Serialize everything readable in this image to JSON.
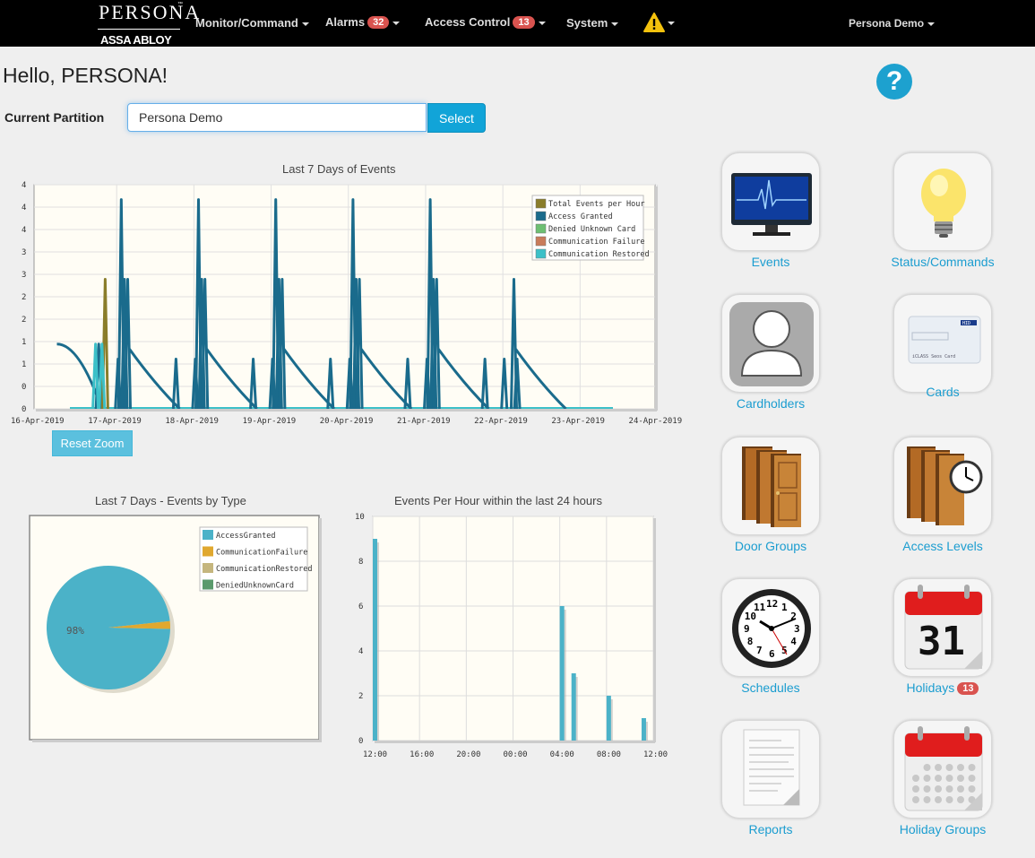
{
  "nav": {
    "logo_top": "PERSONA",
    "logo_tm": "™",
    "logo_bottom": "ASSA ABLOY",
    "items": [
      {
        "label": "Monitor/Command"
      },
      {
        "label": "Alarms",
        "badge": "32"
      },
      {
        "label": "Access Control",
        "badge": "13"
      },
      {
        "label": "System"
      }
    ],
    "warning_icon": "warning-triangle-icon",
    "user": "Persona Demo"
  },
  "greeting": "Hello, PERSONA!",
  "help_icon": "?",
  "partition": {
    "label": "Current Partition",
    "value": "Persona Demo",
    "select_label": "Select"
  },
  "colors": {
    "accent": "#1b9dd0",
    "badge": "#d9534f",
    "access_granted": "#1a6b8c",
    "pie_granted": "#4bb2c8",
    "pie_failure": "#e0a82f"
  },
  "charts": {
    "timeline": {
      "title": "Last 7 Days of Events",
      "y_ticks": [
        "4",
        "4",
        "4",
        "3",
        "3",
        "2",
        "2",
        "1",
        "1",
        "0",
        "0"
      ],
      "x_ticks": [
        "16-Apr-2019",
        "17-Apr-2019",
        "18-Apr-2019",
        "19-Apr-2019",
        "20-Apr-2019",
        "21-Apr-2019",
        "22-Apr-2019",
        "23-Apr-2019",
        "24-Apr-2019"
      ],
      "legend": [
        {
          "name": "Total Events per Hour",
          "color": "#8a7d2a"
        },
        {
          "name": "Access Granted",
          "color": "#1a6b8c"
        },
        {
          "name": "Denied Unknown Card",
          "color": "#6dbf72"
        },
        {
          "name": "Communication Failure",
          "color": "#c97b5a"
        },
        {
          "name": "Communication Restored",
          "color": "#3cc0c8"
        }
      ],
      "reset_label": "Reset Zoom"
    },
    "pie": {
      "title": "Last 7 Days - Events by Type",
      "legend": [
        {
          "name": "AccessGranted",
          "color": "#4bb2c8"
        },
        {
          "name": "CommunicationFailure",
          "color": "#e0a82f"
        },
        {
          "name": "CommunicationRestored",
          "color": "#c5b67e"
        },
        {
          "name": "DeniedUnknownCard",
          "color": "#5a9a6c"
        }
      ],
      "label": "98%"
    },
    "hourly": {
      "title": "Events Per Hour within the last 24 hours",
      "y_ticks": [
        "0",
        "2",
        "4",
        "6",
        "8",
        "10"
      ],
      "x_ticks": [
        "12:00",
        "16:00",
        "20:00",
        "00:00",
        "04:00",
        "08:00",
        "12:00"
      ]
    }
  },
  "chart_data": [
    {
      "type": "line",
      "title": "Last 7 Days of Events",
      "x": [
        "16-Apr-2019",
        "17-Apr-2019",
        "18-Apr-2019",
        "19-Apr-2019",
        "20-Apr-2019",
        "21-Apr-2019",
        "22-Apr-2019",
        "23-Apr-2019",
        "24-Apr-2019"
      ],
      "series": [
        {
          "name": "Access Granted",
          "peaks": [
            {
              "date": "16-Apr-2019 11:00",
              "y": 1.3
            },
            {
              "date": "17-Apr-2019 00:00",
              "y": 1.3
            },
            {
              "date": "17-Apr-2019 06:00",
              "y": 1
            },
            {
              "date": "17-Apr-2019 07:00",
              "y": 4.2
            },
            {
              "date": "17-Apr-2019 08:00",
              "y": 2.6
            },
            {
              "date": "17-Apr-2019 09:00",
              "y": 2.6
            },
            {
              "date": "18-Apr-2019 00:00",
              "y": 1
            },
            {
              "date": "18-Apr-2019 06:00",
              "y": 1
            },
            {
              "date": "18-Apr-2019 07:00",
              "y": 4.2
            },
            {
              "date": "18-Apr-2019 08:00",
              "y": 2.6
            },
            {
              "date": "18-Apr-2019 09:00",
              "y": 2.6
            },
            {
              "date": "19-Apr-2019 00:00",
              "y": 1
            },
            {
              "date": "19-Apr-2019 06:00",
              "y": 1
            },
            {
              "date": "19-Apr-2019 07:00",
              "y": 4.2
            },
            {
              "date": "19-Apr-2019 08:00",
              "y": 2.6
            },
            {
              "date": "19-Apr-2019 09:00",
              "y": 2.6
            },
            {
              "date": "20-Apr-2019 00:00",
              "y": 1
            },
            {
              "date": "20-Apr-2019 06:00",
              "y": 1
            },
            {
              "date": "20-Apr-2019 07:00",
              "y": 4.2
            },
            {
              "date": "20-Apr-2019 08:00",
              "y": 2.6
            },
            {
              "date": "20-Apr-2019 09:00",
              "y": 2.6
            },
            {
              "date": "21-Apr-2019 00:00",
              "y": 1
            },
            {
              "date": "21-Apr-2019 06:00",
              "y": 1
            },
            {
              "date": "21-Apr-2019 07:00",
              "y": 4.2
            },
            {
              "date": "21-Apr-2019 08:00",
              "y": 2.6
            },
            {
              "date": "21-Apr-2019 09:00",
              "y": 2.6
            },
            {
              "date": "22-Apr-2019 00:00",
              "y": 1
            },
            {
              "date": "22-Apr-2019 06:00",
              "y": 1
            },
            {
              "date": "22-Apr-2019 09:00",
              "y": 2.6
            },
            {
              "date": "22-Apr-2019 10:00",
              "y": 1
            }
          ]
        },
        {
          "name": "Total Events per Hour",
          "peaks": [
            {
              "date": "17-Apr-2019 02:00",
              "y": 2.6
            }
          ]
        },
        {
          "name": "Communication Restored",
          "peaks": [
            {
              "date": "16-Apr-2019 23:00",
              "y": 1.3
            },
            {
              "date": "17-Apr-2019 01:00",
              "y": 1.3
            }
          ]
        }
      ],
      "ylim": [
        0,
        4.5
      ]
    },
    {
      "type": "pie",
      "title": "Last 7 Days - Events by Type",
      "categories": [
        "AccessGranted",
        "CommunicationFailure",
        "CommunicationRestored",
        "DeniedUnknownCard"
      ],
      "values": [
        98,
        2,
        0,
        0
      ]
    },
    {
      "type": "bar",
      "title": "Events Per Hour within the last 24 hours",
      "categories": [
        "12:00",
        "04:00",
        "05:00",
        "08:00",
        "11:00"
      ],
      "values": [
        9,
        6,
        3,
        2,
        1
      ],
      "ylim": [
        0,
        10
      ]
    }
  ],
  "tiles": [
    {
      "label": "Events",
      "icon": "monitor-icon"
    },
    {
      "label": "Status/Commands",
      "icon": "lightbulb-icon"
    },
    {
      "label": "Cardholders",
      "icon": "person-icon"
    },
    {
      "label": "Cards",
      "icon": "card-icon",
      "card_text": "iCLASS Seos Card",
      "card_brand": "HID"
    },
    {
      "label": "Door Groups",
      "icon": "doors-icon"
    },
    {
      "label": "Access Levels",
      "icon": "doors-clock-icon"
    },
    {
      "label": "Schedules",
      "icon": "clock-icon"
    },
    {
      "label": "Holidays",
      "icon": "calendar-icon",
      "badge": "13",
      "day": "31"
    },
    {
      "label": "Reports",
      "icon": "report-icon"
    },
    {
      "label": "Holiday Groups",
      "icon": "calendar-grid-icon"
    }
  ]
}
